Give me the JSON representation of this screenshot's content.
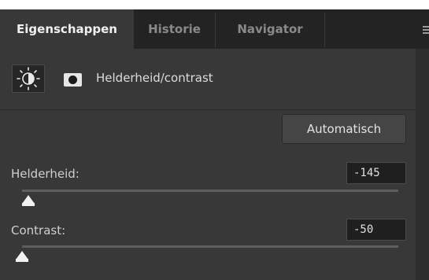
{
  "tabs": [
    {
      "label": "Eigenschappen",
      "active": true
    },
    {
      "label": "Historie",
      "active": false
    },
    {
      "label": "Navigator",
      "active": false
    }
  ],
  "header": {
    "adjustment_icon": "brightness-sun-icon",
    "mask_icon": "layer-mask-icon",
    "title": "Helderheid/contrast"
  },
  "auto_button_label": "Automatisch",
  "brightness": {
    "label": "Helderheid:",
    "value": "-145",
    "min": -150,
    "max": 150
  },
  "contrast": {
    "label": "Contrast:",
    "value": "-50",
    "min": -50,
    "max": 100
  },
  "colors": {
    "panel": "#383838",
    "tabbar": "#232323",
    "accent": "#f2f2f2"
  }
}
